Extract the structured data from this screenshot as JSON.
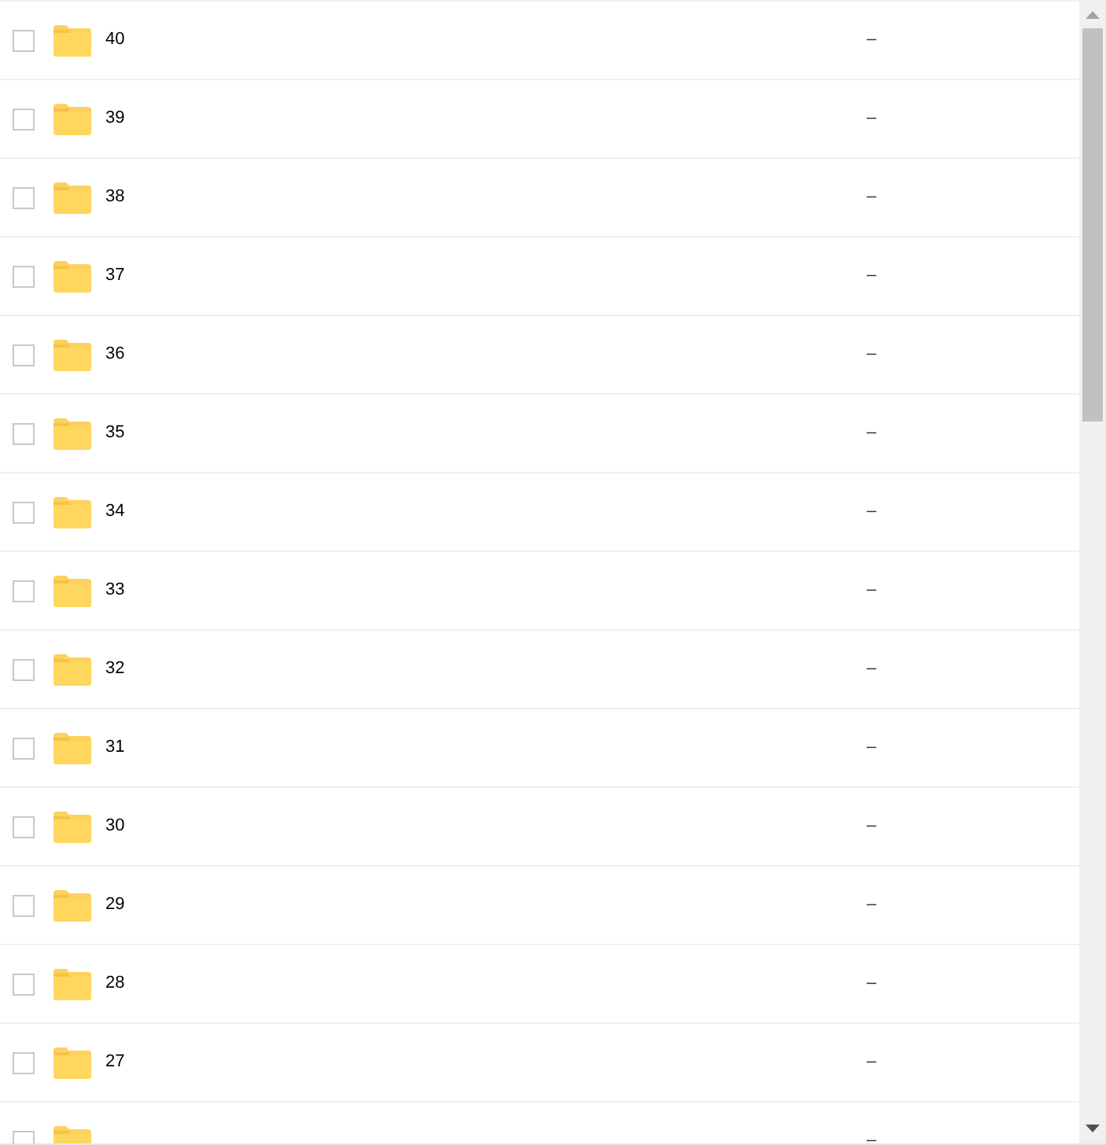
{
  "rows": [
    {
      "name": "40",
      "size": "–",
      "checked": false
    },
    {
      "name": "39",
      "size": "–",
      "checked": false
    },
    {
      "name": "38",
      "size": "–",
      "checked": false
    },
    {
      "name": "37",
      "size": "–",
      "checked": false
    },
    {
      "name": "36",
      "size": "–",
      "checked": false
    },
    {
      "name": "35",
      "size": "–",
      "checked": false
    },
    {
      "name": "34",
      "size": "–",
      "checked": false
    },
    {
      "name": "33",
      "size": "–",
      "checked": false
    },
    {
      "name": "32",
      "size": "–",
      "checked": false
    },
    {
      "name": "31",
      "size": "–",
      "checked": false
    },
    {
      "name": "30",
      "size": "–",
      "checked": false
    },
    {
      "name": "29",
      "size": "–",
      "checked": false
    },
    {
      "name": "28",
      "size": "–",
      "checked": false
    },
    {
      "name": "27",
      "size": "–",
      "checked": false
    },
    {
      "size": "–",
      "checked": false
    }
  ]
}
